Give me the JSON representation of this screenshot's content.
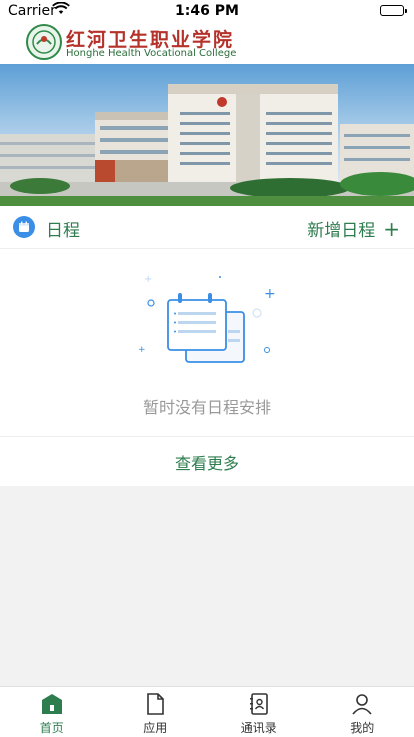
{
  "status_bar": {
    "carrier": "Carrier",
    "time": "1:46 PM"
  },
  "header": {
    "college_name_cn": "红河卫生职业学院",
    "college_name_en": "Honghe Health Vocational College"
  },
  "schedule": {
    "title": "日程",
    "add_label": "新增日程",
    "add_icon": "plus-icon",
    "empty_text": "暂时没有日程安排",
    "view_more": "查看更多"
  },
  "tabbar": {
    "items": [
      {
        "label": "首页",
        "icon": "home-icon",
        "active": true
      },
      {
        "label": "应用",
        "icon": "document-icon",
        "active": false
      },
      {
        "label": "通讯录",
        "icon": "contacts-icon",
        "active": false
      },
      {
        "label": "我的",
        "icon": "profile-icon",
        "active": false
      }
    ]
  },
  "colors": {
    "accent": "#2e7d4f",
    "calendar_blue": "#3a8ee6",
    "logo_red": "#b5322b"
  }
}
